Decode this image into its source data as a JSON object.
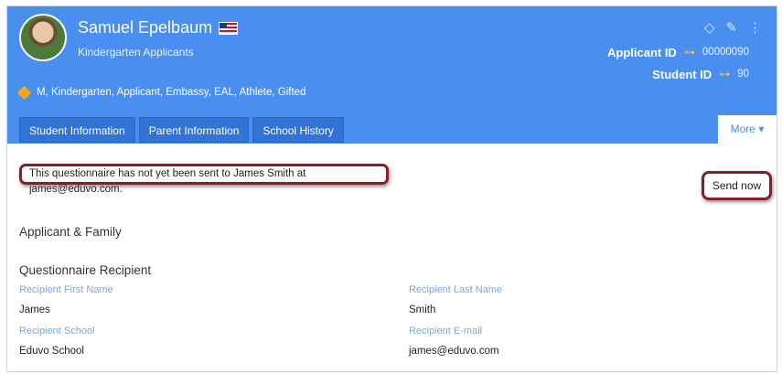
{
  "applicant": {
    "name": "Samuel Epelbaum",
    "group": "Kindergarten Applicants",
    "tags": "M, Kindergarten, Applicant,  Embassy,  EAL,  Athlete,  Gifted",
    "applicant_id_label": "Applicant ID",
    "applicant_id": "00000090",
    "student_id_label": "Student ID",
    "student_id": "90"
  },
  "tabs": [
    {
      "label": "Student Information"
    },
    {
      "label": "Parent Information"
    },
    {
      "label": "School History"
    }
  ],
  "more_tab": "More ▾",
  "notice": "This questionnaire has not yet been sent to James Smith at james@eduvo.com.",
  "send_button": "Send now",
  "section_title": "Applicant & Family",
  "recipient": {
    "title": "Questionnaire Recipient",
    "first_name_label": "Recipient First Name",
    "first_name": "James",
    "last_name_label": "Recipient Last Name",
    "last_name": "Smith",
    "school_label": "Recipient School",
    "school": "Eduvo School",
    "email_label": "Recipient E-mail",
    "email": "james@eduvo.com"
  },
  "icons": {
    "tag": "tag-icon",
    "edit": "pencil-icon",
    "menu": "kebab-menu-icon",
    "key": "key-icon",
    "flag": "us-flag-icon"
  },
  "colors": {
    "header": "#4a8ef0",
    "tab": "#3273d6",
    "highlight": "#8b1d2b",
    "label": "#7fa6d6"
  }
}
